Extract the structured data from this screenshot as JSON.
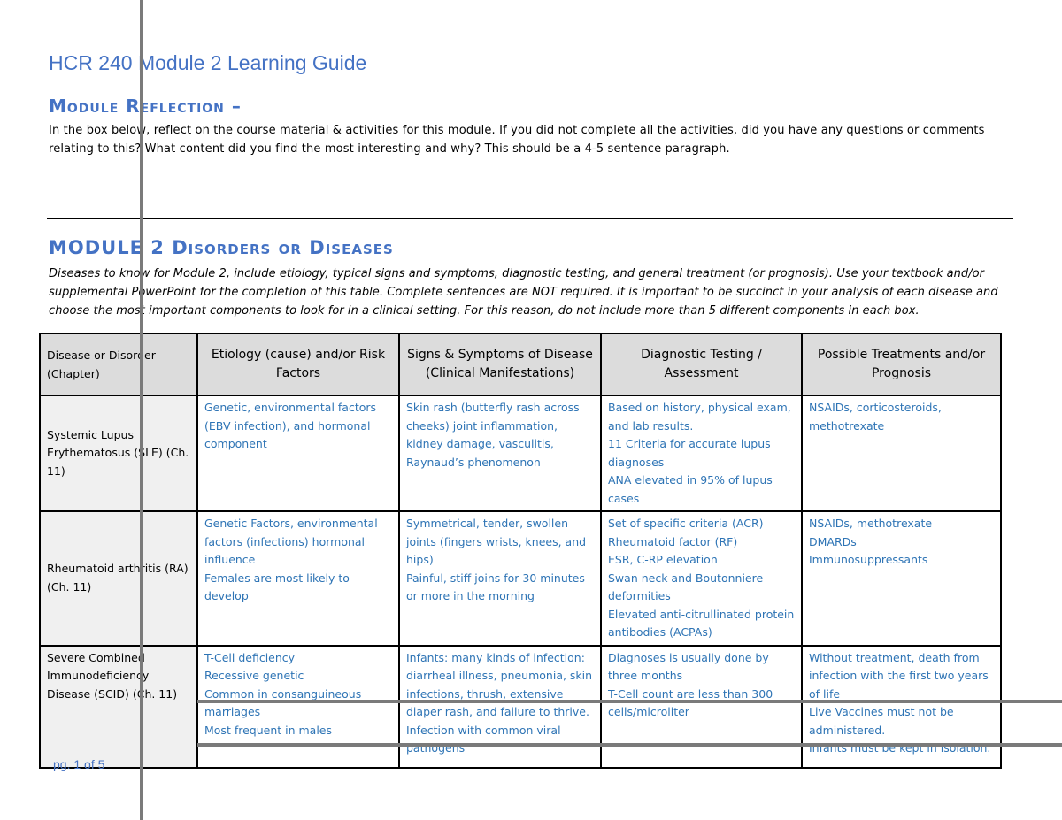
{
  "document": {
    "title": "HCR 240 Module 2 Learning Guide",
    "page_indicator": "pg. 1 of 5"
  },
  "reflection": {
    "heading": "Module Reflection –",
    "instructions": "In the box below, reflect on the course material & activities for this module.  If you did not complete all the activities, did you have any questions or comments relating to this?  What content did you find the most interesting and why?  This should be a 4-5 sentence paragraph."
  },
  "disorders": {
    "heading": "MODULE 2 Disorders or Diseases",
    "instructions": "Diseases to know for Module 2, include etiology, typical signs and symptoms, diagnostic testing, and general treatment (or prognosis).  Use your textbook and/or supplemental PowerPoint for the completion of this table.  Complete sentences are NOT required.   It is important to be succinct in your analysis of each disease and choose the most important components to look for in a clinical setting. For this reason, do not include more than 5 different components in each box."
  },
  "table": {
    "headers": [
      "Disease or Disorder (Chapter)",
      "Etiology (cause) and/or Risk Factors",
      "Signs & Symptoms of Disease (Clinical Manifestations)",
      "Diagnostic Testing / Assessment",
      "Possible Treatments and/or Prognosis"
    ],
    "rows": [
      {
        "disease": "Systemic Lupus Erythematosus (SLE) (Ch. 11)",
        "etiology": [
          "Genetic, environmental factors (EBV infection), and hormonal component"
        ],
        "signs": [
          "Skin rash (butterfly rash across cheeks) joint inflammation, kidney damage, vasculitis, Raynaud’s phenomenon"
        ],
        "diagnostics": [
          "Based on history, physical exam, and lab results.",
          "11 Criteria for accurate lupus diagnoses",
          "ANA elevated in 95% of lupus cases"
        ],
        "treatment": [
          "NSAIDs, corticosteroids, methotrexate"
        ]
      },
      {
        "disease": "Rheumatoid arthritis (RA) (Ch. 11)",
        "etiology": [
          "Genetic Factors, environmental factors (infections) hormonal influence",
          "Females are most likely to develop"
        ],
        "signs": [
          "Symmetrical, tender, swollen joints (fingers wrists, knees, and hips)",
          "Painful, stiff joins for 30 minutes or more in the morning"
        ],
        "diagnostics": [
          "Set of specific criteria (ACR)",
          "Rheumatoid factor (RF)",
          "ESR, C-RP elevation",
          "Swan neck and Boutonniere deformities",
          "Elevated anti-citrullinated protein antibodies  (ACPAs)"
        ],
        "treatment": [
          "NSAIDs, methotrexate",
          "DMARDs",
          "Immunosuppressants"
        ]
      },
      {
        "disease": "Severe Combined Immunodeficiency Disease (SCID) (Ch. 11)",
        "etiology": [
          "T-Cell deficiency",
          "Recessive genetic",
          "Common in consanguineous marriages",
          "Most frequent in males"
        ],
        "signs": [
          "Infants: many kinds of infection: diarrheal illness, pneumonia, skin infections, thrush, extensive diaper rash, and failure to thrive.",
          "Infection with common viral pathogens"
        ],
        "diagnostics": [
          "Diagnoses is usually done by three months",
          "T-Cell count are less than 300 cells/microliter"
        ],
        "treatment": [
          "Without treatment, death from infection with the first two years of life",
          "Live Vaccines must not be administered.",
          "Infants must be kept in isolation."
        ]
      }
    ]
  },
  "colors": {
    "heading_blue": "#4472c4",
    "cell_text_blue": "#2e74b5",
    "header_bg": "#dcdcdc",
    "name_cell_bg": "#f0f0f0"
  }
}
